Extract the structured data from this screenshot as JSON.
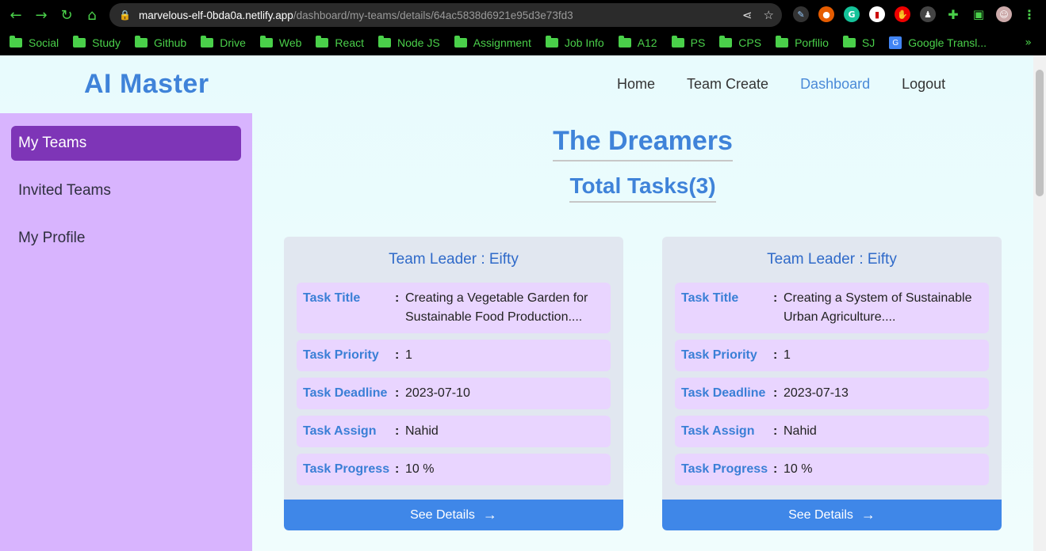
{
  "browser": {
    "url_host": "marvelous-elf-0bda0a.netlify.app",
    "url_path": "/dashboard/my-teams/details/64ac5838d6921e95d3e73fd3",
    "bookmarks": [
      "Social",
      "Study",
      "Github",
      "Drive",
      "Web",
      "React",
      "Node JS",
      "Assignment",
      "Job Info",
      "A12",
      "PS",
      "CPS",
      "Porfilio",
      "SJ"
    ],
    "google_translate": "Google Transl...",
    "more": "»"
  },
  "header": {
    "brand": "AI Master",
    "nav": [
      "Home",
      "Team Create",
      "Dashboard",
      "Logout"
    ],
    "active_nav": "Dashboard"
  },
  "sidebar": {
    "items": [
      "My Teams",
      "Invited Teams",
      "My Profile"
    ],
    "active": "My Teams"
  },
  "main": {
    "team_name": "The Dreamers",
    "total_tasks": "Total Tasks(3)",
    "cards": [
      {
        "leader": "Team Leader : Eifty",
        "fields": [
          {
            "label": "Task Title",
            "value": "Creating a Vegetable Garden for Sustainable Food Production...."
          },
          {
            "label": "Task Priority",
            "value": "1"
          },
          {
            "label": "Task Deadline",
            "value": "2023-07-10"
          },
          {
            "label": "Task Assign",
            "value": "Nahid"
          },
          {
            "label": "Task Progress",
            "value": "10 %"
          }
        ],
        "button": "See Details"
      },
      {
        "leader": "Team Leader : Eifty",
        "fields": [
          {
            "label": "Task Title",
            "value": "Creating a System of Sustainable Urban Agriculture...."
          },
          {
            "label": "Task Priority",
            "value": "1"
          },
          {
            "label": "Task Deadline",
            "value": "2023-07-13"
          },
          {
            "label": "Task Assign",
            "value": "Nahid"
          },
          {
            "label": "Task Progress",
            "value": "10 %"
          }
        ],
        "button": "See Details"
      }
    ]
  },
  "colors": {
    "brand": "#3f83d9",
    "sidebar_bg": "#d8b4fe",
    "sidebar_active": "#7e35b7",
    "card_bg": "#e1e7f0",
    "row_bg": "#e9d5ff",
    "button": "#3f87e8"
  }
}
